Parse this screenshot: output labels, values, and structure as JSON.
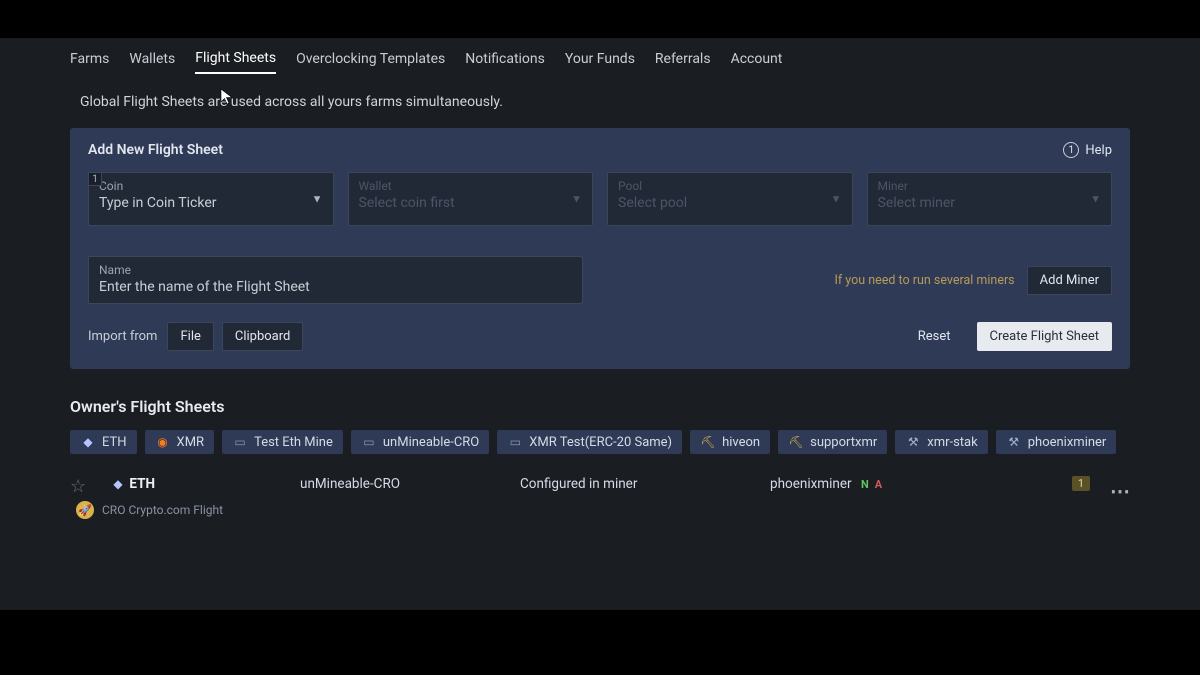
{
  "nav": {
    "items": [
      {
        "label": "Farms"
      },
      {
        "label": "Wallets"
      },
      {
        "label": "Flight Sheets",
        "active": true
      },
      {
        "label": "Overclocking Templates"
      },
      {
        "label": "Notifications"
      },
      {
        "label": "Your Funds"
      },
      {
        "label": "Referrals"
      },
      {
        "label": "Account"
      }
    ]
  },
  "info": "Global Flight Sheets are used across all yours farms simultaneously.",
  "panel": {
    "title": "Add New Flight Sheet",
    "help": "Help",
    "help_num": "1",
    "badge": "1",
    "fields": {
      "coin": {
        "label": "Coin",
        "placeholder": "Type in Coin Ticker"
      },
      "wallet": {
        "label": "Wallet",
        "placeholder": "Select coin first"
      },
      "pool": {
        "label": "Pool",
        "placeholder": "Select pool"
      },
      "miner": {
        "label": "Miner",
        "placeholder": "Select miner"
      }
    },
    "name": {
      "label": "Name",
      "placeholder": "Enter the name of the Flight Sheet"
    },
    "add_miner_note": "If you need to run several miners",
    "add_miner": "Add Miner",
    "import_label": "Import from",
    "file": "File",
    "clipboard": "Clipboard",
    "reset": "Reset",
    "create": "Create Flight Sheet"
  },
  "owner": {
    "title": "Owner's Flight Sheets",
    "chips": [
      {
        "icon": "eth",
        "label": "ETH"
      },
      {
        "icon": "xmr",
        "label": "XMR"
      },
      {
        "icon": "card",
        "label": "Test Eth Mine"
      },
      {
        "icon": "card",
        "label": "unMineable-CRO"
      },
      {
        "icon": "card",
        "label": "XMR Test(ERC-20 Same)"
      },
      {
        "icon": "bee",
        "label": "hiveon"
      },
      {
        "icon": "bee",
        "label": "supportxmr"
      },
      {
        "icon": "pick",
        "label": "xmr-stak"
      },
      {
        "icon": "pick",
        "label": "phoenixminer"
      }
    ],
    "sheet": {
      "coin": "ETH",
      "wallet": "unMineable-CRO",
      "pool": "Configured in miner",
      "miner": "phoenixminer",
      "tag_n": "N",
      "tag_a": "A",
      "count": "1",
      "sub": "CRO Crypto.com Flight"
    }
  }
}
